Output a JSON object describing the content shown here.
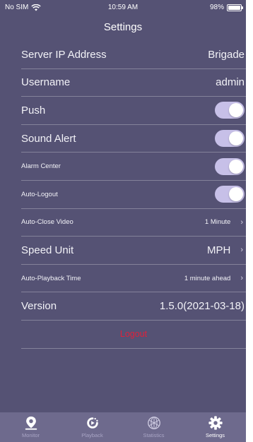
{
  "status_bar": {
    "carrier": "No SIM",
    "time": "10:59 AM",
    "battery": "98%"
  },
  "nav": {
    "title": "Settings"
  },
  "settings": {
    "server_ip": {
      "label": "Server IP Address",
      "value": "Brigade"
    },
    "username": {
      "label": "Username",
      "value": "admin"
    },
    "push": {
      "label": "Push",
      "enabled": true
    },
    "sound_alert": {
      "label": "Sound Alert",
      "enabled": true
    },
    "alarm_center": {
      "label": "Alarm Center",
      "enabled": true
    },
    "auto_logout": {
      "label": "Auto-Logout",
      "enabled": true
    },
    "auto_close_video": {
      "label": "Auto-Close Video",
      "value": "1 Minute"
    },
    "speed_unit": {
      "label": "Speed Unit",
      "value": "MPH"
    },
    "auto_playback_time": {
      "label": "Auto-Playback Time",
      "value": "1 minute ahead"
    },
    "version": {
      "label": "Version",
      "value": "1.5.0(2021-03-18)"
    },
    "logout": {
      "label": "Logout"
    }
  },
  "colors": {
    "background": "#555274",
    "tabbar": "#6e6a8d",
    "toggle_on": "#c7c0e8",
    "logout": "#e0203a"
  },
  "tabs": [
    {
      "label": "Monitor",
      "icon": "map-pin-icon",
      "active": false
    },
    {
      "label": "Playback",
      "icon": "playback-icon",
      "active": false
    },
    {
      "label": "Statistics",
      "icon": "globe-icon",
      "active": false
    },
    {
      "label": "Settings",
      "icon": "gear-icon",
      "active": true
    }
  ],
  "chevron": "›"
}
